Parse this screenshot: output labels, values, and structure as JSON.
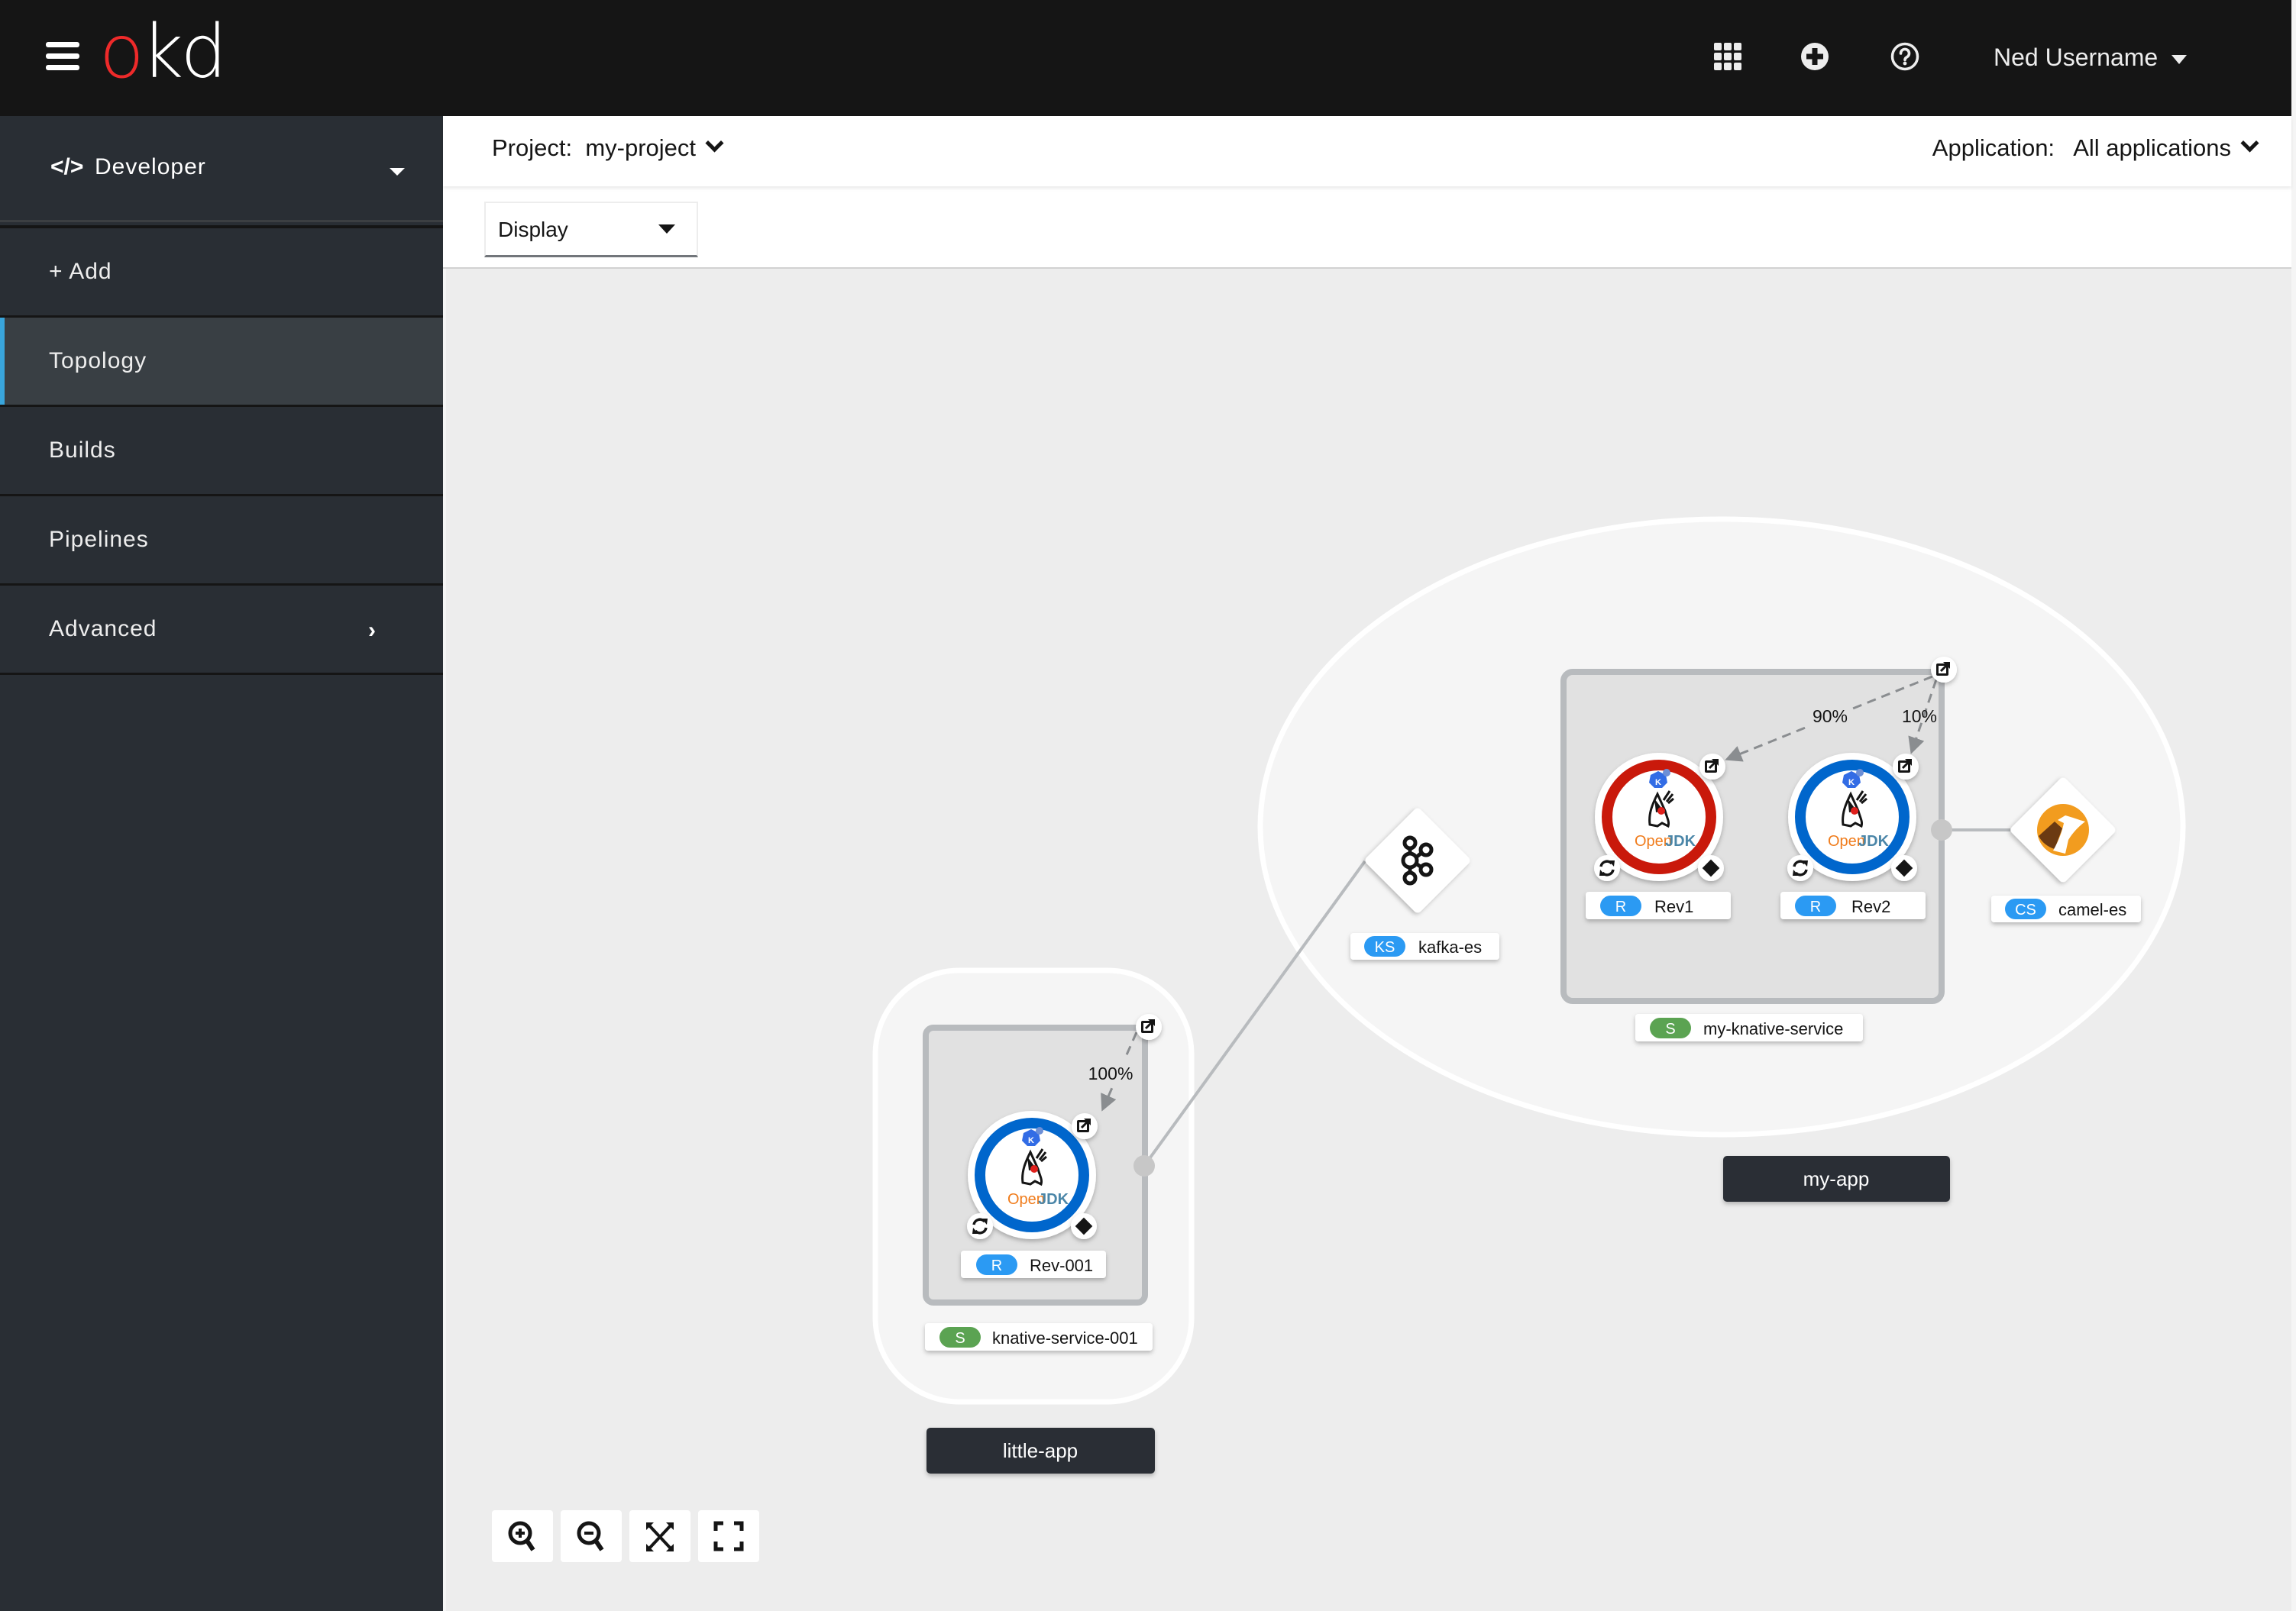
{
  "masthead": {
    "brand_o": "o",
    "brand_rest": "kd",
    "icons": [
      "app-launcher-icon",
      "import-plus-icon",
      "help-icon"
    ],
    "user_name": "Ned Username"
  },
  "sidebar": {
    "perspective": {
      "icon": "code-icon",
      "label": "Developer"
    },
    "items": [
      {
        "label": "+ Add",
        "active": false
      },
      {
        "label": "Topology",
        "active": true
      },
      {
        "label": "Builds",
        "active": false
      },
      {
        "label": "Pipelines",
        "active": false
      },
      {
        "label": "Advanced",
        "active": false,
        "has_children": true
      }
    ]
  },
  "context_bar": {
    "project_label": "Project:",
    "project_value": "my-project",
    "application_label": "Application:",
    "application_value": "All applications"
  },
  "toolbar": {
    "display_label": "Display"
  },
  "topology": {
    "groups": [
      {
        "name": "my-app"
      },
      {
        "name": "little-app"
      }
    ],
    "services": [
      {
        "badge": "S",
        "badge_color": "#5ba352",
        "name": "my-knative-service",
        "traffic": [
          {
            "revision": "Rev1",
            "percent": "90%"
          },
          {
            "revision": "Rev2",
            "percent": "10%"
          }
        ]
      },
      {
        "badge": "S",
        "badge_color": "#5ba352",
        "name": "knative-service-001",
        "traffic": [
          {
            "revision": "Rev-001",
            "percent": "100%"
          }
        ]
      }
    ],
    "revisions": [
      {
        "badge": "R",
        "name": "Rev1",
        "status_color": "#c9190b",
        "runtime": "OpenJDK"
      },
      {
        "badge": "R",
        "name": "Rev2",
        "status_color": "#0066cc",
        "runtime": "OpenJDK"
      },
      {
        "badge": "R",
        "name": "Rev-001",
        "status_color": "#0066cc",
        "runtime": "OpenJDK"
      }
    ],
    "event_sources": [
      {
        "badge": "KS",
        "name": "kafka-es",
        "icon": "kafka-icon"
      },
      {
        "badge": "CS",
        "name": "camel-es",
        "icon": "camel-icon"
      }
    ],
    "badge_color": "#2b9af3",
    "runtime_open": "Open",
    "runtime_jdk": "JDK"
  },
  "zoom_controls": [
    "zoom-in-icon",
    "zoom-out-icon",
    "fit-to-screen-icon",
    "reset-view-icon"
  ]
}
